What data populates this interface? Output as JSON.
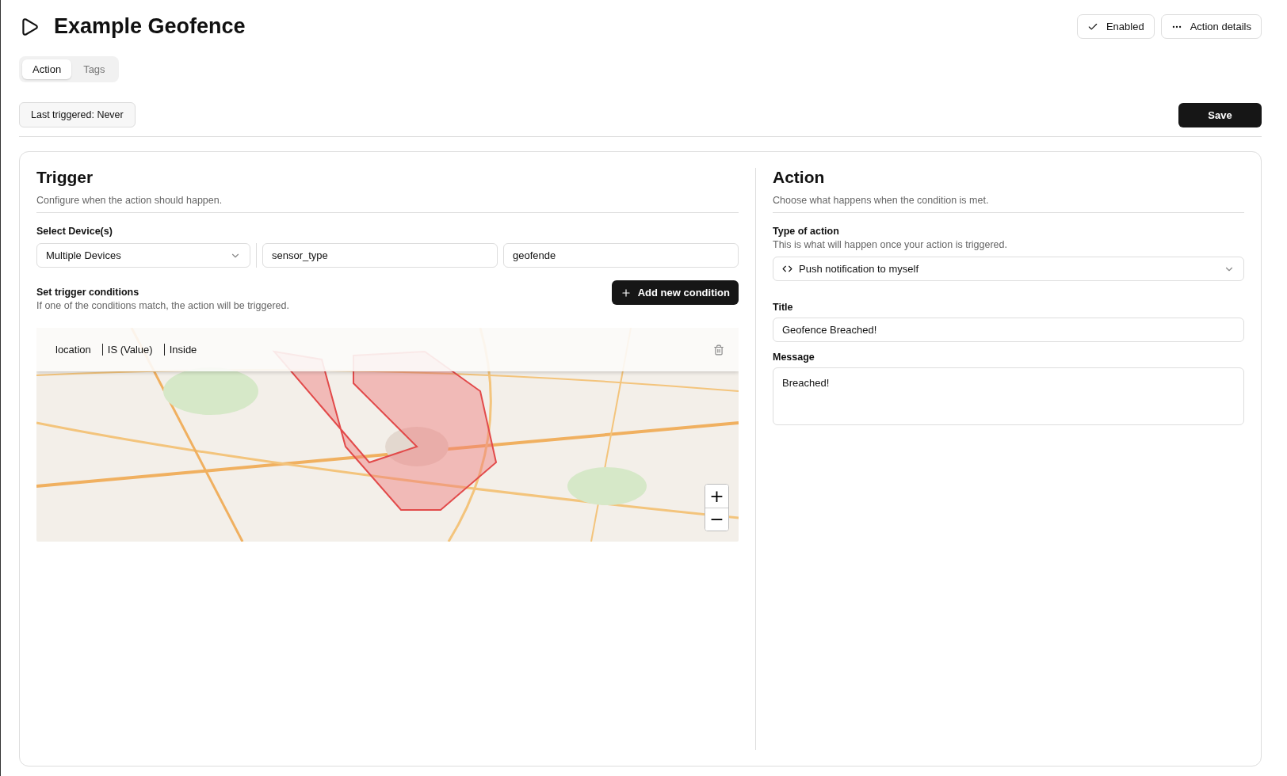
{
  "header": {
    "title": "Example Geofence",
    "enabled_button": {
      "label": "Enabled",
      "checked": true
    },
    "details_button": {
      "label": "Action details"
    }
  },
  "tabs": [
    {
      "label": "Action",
      "selected": true
    },
    {
      "label": "Tags",
      "selected": false
    }
  ],
  "status": {
    "last_triggered": "Last triggered: Never",
    "save": "Save"
  },
  "trigger": {
    "title": "Trigger",
    "subtitle": "Configure when the action should happen.",
    "device_label": "Select Device(s)",
    "device_select": "Multiple Devices",
    "field_1": "sensor_type",
    "field_2": "geofende",
    "conditions_title": "Set trigger conditions",
    "conditions_hint": "If one of the conditions match, the action will be triggered.",
    "add_button": "Add new condition",
    "condition": {
      "parts": [
        "location",
        "IS (Value)",
        "Inside"
      ]
    },
    "map": {
      "kind": "picture",
      "zoom_in": "+",
      "zoom_out": "−"
    }
  },
  "action": {
    "title": "Action",
    "subtitle": "Choose what happens when the condition is met.",
    "type_label": "Type of action",
    "type_hint": "This is what will happen once your action is triggered.",
    "type_select": "Push notification to myself",
    "title_label": "Title",
    "title_value": "Geofence Breached!",
    "message_label": "Message",
    "message_value": "Breached!"
  }
}
